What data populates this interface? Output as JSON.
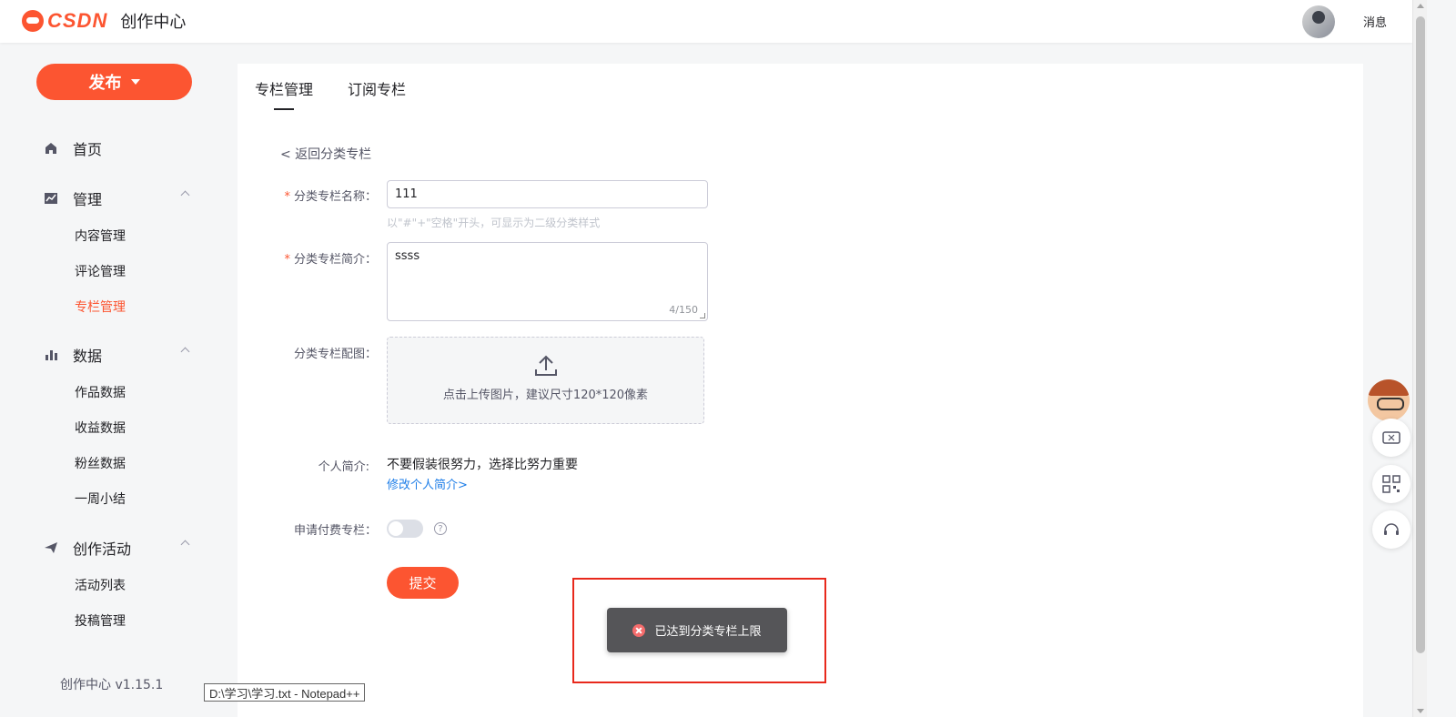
{
  "header": {
    "logo_text": "CSDN",
    "subtitle": "创作中心",
    "messages_label": "消息"
  },
  "sidebar": {
    "publish_label": "发布",
    "home_label": "首页",
    "sections": [
      {
        "label": "管理",
        "icon": "chart-line-icon",
        "items": [
          "内容管理",
          "评论管理",
          "专栏管理"
        ]
      },
      {
        "label": "数据",
        "icon": "bar-chart-icon",
        "items": [
          "作品数据",
          "收益数据",
          "粉丝数据",
          "一周小结"
        ]
      },
      {
        "label": "创作活动",
        "icon": "paper-plane-icon",
        "items": [
          "活动列表",
          "投稿管理"
        ]
      }
    ],
    "active_item": "专栏管理",
    "version": "创作中心 v1.15.1"
  },
  "tabs": [
    {
      "label": "专栏管理",
      "active": true
    },
    {
      "label": "订阅专栏",
      "active": false
    }
  ],
  "form": {
    "back_link": "< 返回分类专栏",
    "name_label": "分类专栏名称：",
    "name_value": "111",
    "name_hint": "以\"#\"+\"空格\"开头，可显示为二级分类样式",
    "intro_label": "分类专栏简介：",
    "intro_value": "ssss",
    "intro_counter": "4/150",
    "image_label": "分类专栏配图：",
    "upload_text": "点击上传图片，建议尺寸120*120像素",
    "personal_label": "个人简介:",
    "personal_text": "不要假装很努力，选择比努力重要",
    "personal_link": "修改个人简介>",
    "paid_label": "申请付费专栏：",
    "paid_enabled": false,
    "help_symbol": "?",
    "submit_label": "提交"
  },
  "toast": {
    "message": "已达到分类专栏上限",
    "type": "error"
  },
  "taskbar_tooltip": "D:\\学习\\学习.txt - Notepad++",
  "colors": {
    "brand": "#fc5531",
    "link": "#1e7ee8",
    "highlight": "#e8291c"
  }
}
